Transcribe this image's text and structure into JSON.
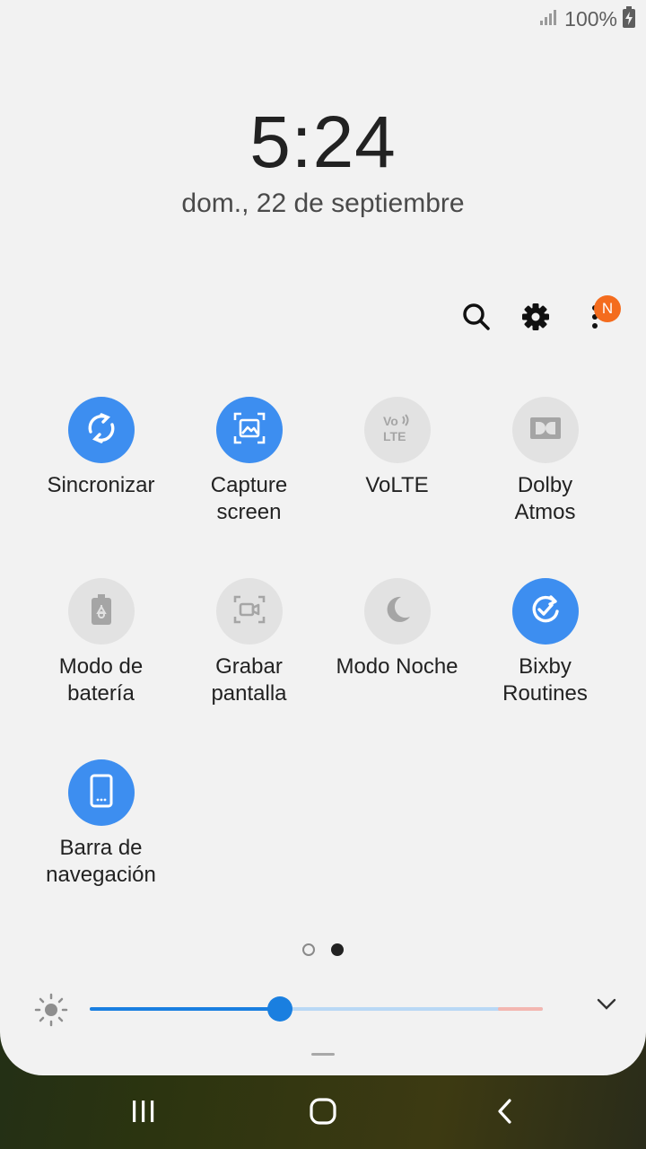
{
  "status_bar": {
    "battery_percent": "100%",
    "signal_icon": "signal-icon",
    "battery_icon": "battery-charging-icon"
  },
  "lock_info": {
    "time": "5:24",
    "date": "dom., 22 de septiembre"
  },
  "toolbar": {
    "search_icon": "search-icon",
    "settings_icon": "gear-icon",
    "more_icon": "more-vertical-icon",
    "notification_badge": "N",
    "badge_color": "#f46c1e"
  },
  "tiles": [
    {
      "label": "Sincronizar",
      "icon": "sync-icon",
      "state": "on"
    },
    {
      "label": "Capture\nscreen",
      "icon": "screenshot-icon",
      "state": "on"
    },
    {
      "label": "VoLTE",
      "icon": "volte-icon",
      "state": "off"
    },
    {
      "label": "Dolby\nAtmos",
      "icon": "dolby-icon",
      "state": "off"
    },
    {
      "label": "Modo de\nbatería",
      "icon": "battery-mode-icon",
      "state": "off"
    },
    {
      "label": "Grabar\npantalla",
      "icon": "screen-record-icon",
      "state": "off"
    },
    {
      "label": "Modo Noche",
      "icon": "moon-icon",
      "state": "off"
    },
    {
      "label": "Bixby\nRoutines",
      "icon": "bixby-routines-icon",
      "state": "on"
    },
    {
      "label": "Barra de\nnavegación",
      "icon": "phone-nav-icon",
      "state": "on"
    }
  ],
  "pager": {
    "pages": 2,
    "current": 2
  },
  "brightness": {
    "level": 0.42,
    "sun_icon": "brightness-icon",
    "expand_icon": "chevron-down-icon"
  },
  "colors": {
    "accent": "#3d8ef0",
    "tile_off": "#e2e2e2",
    "panel_bg": "#f2f2f2",
    "slider": "#1a7fe0"
  },
  "navigation": {
    "recents_icon": "recents-icon",
    "home_icon": "home-icon",
    "back_icon": "back-icon"
  }
}
